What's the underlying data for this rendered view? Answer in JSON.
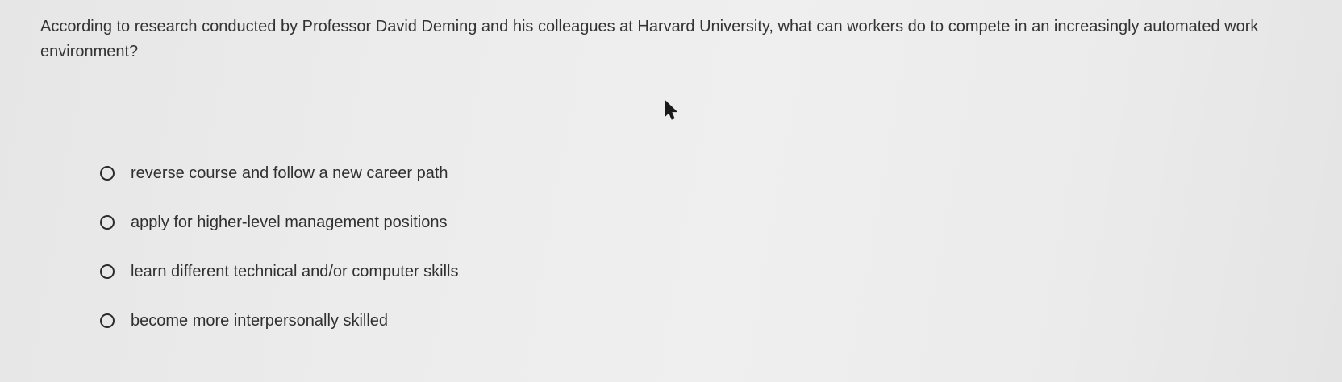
{
  "question": {
    "text": "According to research conducted by Professor David Deming and his colleagues at Harvard University, what can workers do to compete in an increasingly automated work environment?"
  },
  "options": [
    {
      "label": "reverse course and follow a new career path",
      "selected": false
    },
    {
      "label": "apply for higher-level management positions",
      "selected": false
    },
    {
      "label": "learn different technical and/or computer skills",
      "selected": false
    },
    {
      "label": "become more interpersonally skilled",
      "selected": false
    }
  ],
  "cursor": {
    "icon": "mouse-pointer-icon"
  }
}
